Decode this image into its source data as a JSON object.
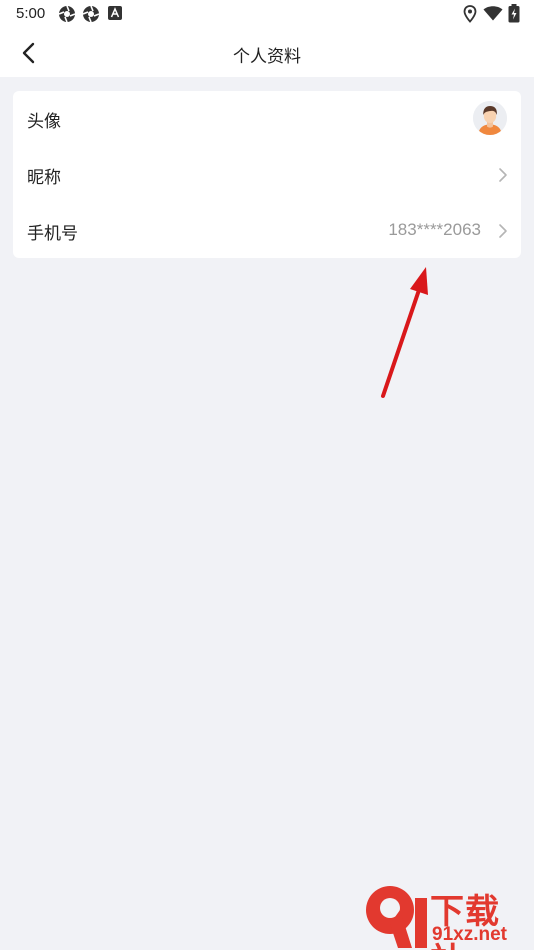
{
  "status_bar": {
    "time": "5:00",
    "left_icons": [
      "aperture-icon",
      "aperture-icon",
      "font-a-icon"
    ],
    "right_icons": [
      "location-pin-icon",
      "wifi-icon",
      "battery-charging-icon"
    ]
  },
  "header": {
    "back_icon": "chevron-left-icon",
    "title": "个人资料"
  },
  "profile": {
    "rows": [
      {
        "label": "头像",
        "type": "avatar"
      },
      {
        "label": "昵称",
        "value": "",
        "type": "link"
      },
      {
        "label": "手机号",
        "value": "183****2063",
        "type": "link"
      }
    ]
  },
  "watermark": {
    "title": "下载站",
    "url": "91xz.net"
  },
  "colors": {
    "background": "#f1f2f6",
    "card": "#ffffff",
    "text": "#222222",
    "value_text": "#9a9a9a",
    "chevron": "#b5b5b5",
    "annotation_arrow": "#d9181b",
    "watermark": "#e2392f"
  }
}
